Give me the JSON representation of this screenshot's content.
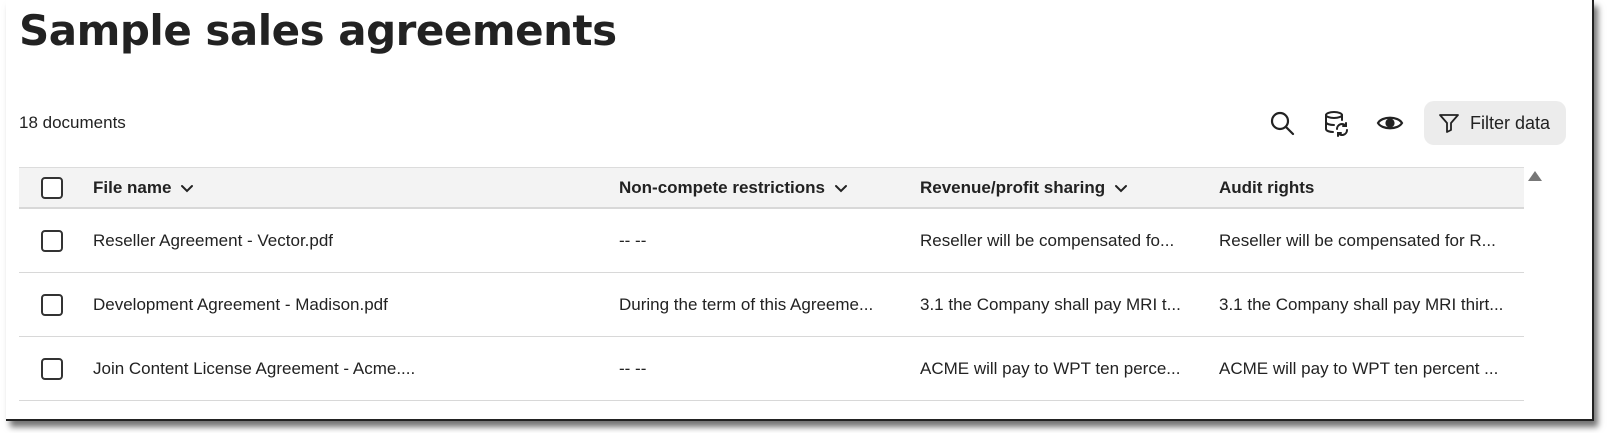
{
  "page": {
    "title": "Sample sales agreements",
    "doc_count": "18 documents"
  },
  "toolbar": {
    "search_icon": "search-icon",
    "database_refresh_icon": "database-refresh-icon",
    "eye_icon": "eye-icon",
    "filter_label": "Filter data"
  },
  "table": {
    "columns": [
      {
        "label": "File name",
        "sortable": true
      },
      {
        "label": "Non-compete restrictions",
        "sortable": true
      },
      {
        "label": "Revenue/profit sharing",
        "sortable": true
      },
      {
        "label": "Audit rights",
        "sortable": false
      }
    ],
    "rows": [
      {
        "file": "Reseller Agreement - Vector.pdf",
        "noncompete": "-- --",
        "revenue": "Reseller will be compensated fo...",
        "audit": "Reseller will be compensated for R..."
      },
      {
        "file": "Development Agreement - Madison.pdf",
        "noncompete": "During the term of this Agreeme...",
        "revenue": "3.1 the Company shall pay MRI t...",
        "audit": "3.1 the Company shall pay MRI thirt..."
      },
      {
        "file": "Join Content License Agreement - Acme....",
        "noncompete": "-- --",
        "revenue": "ACME will pay to WPT ten perce...",
        "audit": "ACME will pay to WPT ten percent ..."
      }
    ]
  },
  "colors": {
    "text": "#222222",
    "header_bg": "#f3f3f3",
    "filter_bg": "#ececec",
    "divider": "#d8d8d8"
  }
}
